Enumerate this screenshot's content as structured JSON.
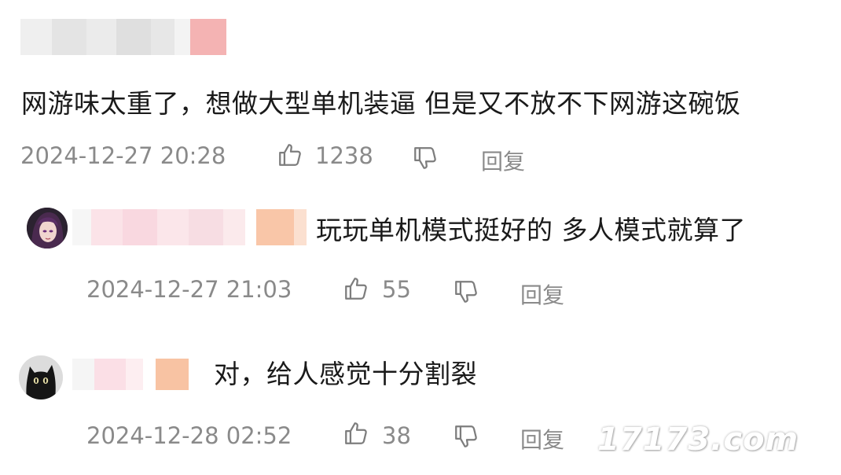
{
  "comments": [
    {
      "text": "网游味太重了，想做大型单机装逼 但是又不放不下网游这碗饭",
      "time": "2024-12-27 20:28",
      "likes": "1238",
      "reply_label": "回复",
      "level": "top"
    },
    {
      "text": "玩玩单机模式挺好的 多人模式就算了",
      "time": "2024-12-27 21:03",
      "likes": "55",
      "reply_label": "回复",
      "level": "reply",
      "avatar_icon": "anime-avatar"
    },
    {
      "text": "对，给人感觉十分割裂",
      "time": "2024-12-28 02:52",
      "likes": "38",
      "reply_label": "回复",
      "level": "reply",
      "avatar_icon": "black-cat-avatar"
    }
  ],
  "icons": {
    "like": "thumbs-up-icon",
    "dislike": "thumbs-down-icon"
  },
  "watermark": "17173.com",
  "colors": {
    "meta_text": "#8a8a8a",
    "body_text": "#1a1a1a",
    "blur_pink": "#f6b8b8",
    "blur_orange": "#f9c9a6"
  }
}
